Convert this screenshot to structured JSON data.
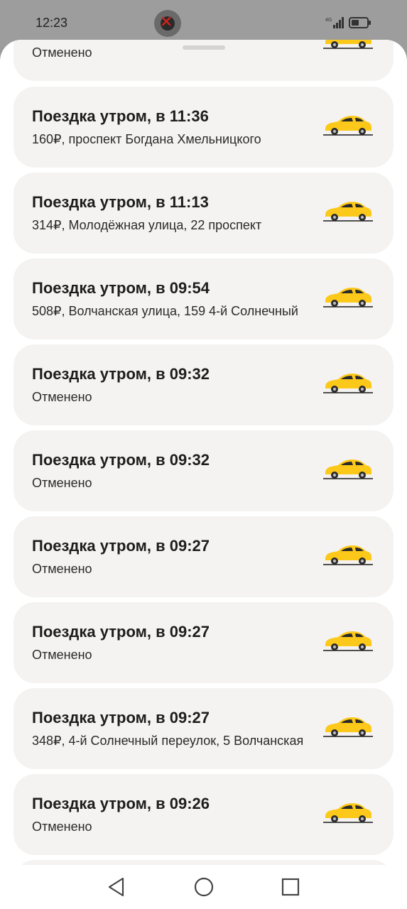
{
  "status_bar": {
    "time": "12:23",
    "network": "4G",
    "icons": [
      "notification-app-icon",
      "signal-icon",
      "battery-icon"
    ]
  },
  "trips": [
    {
      "title": "",
      "subtitle": "Отменено"
    },
    {
      "title": "Поездка утром, в 11:36",
      "subtitle": "160₽, проспект Богдана Хмельницкого"
    },
    {
      "title": "Поездка утром, в 11:13",
      "subtitle": "314₽, Молодёжная улица, 22 проспект"
    },
    {
      "title": "Поездка утром, в 09:54",
      "subtitle": "508₽, Волчанская улица, 159 4-й Солнечный"
    },
    {
      "title": "Поездка утром, в 09:32",
      "subtitle": "Отменено"
    },
    {
      "title": "Поездка утром, в 09:32",
      "subtitle": "Отменено"
    },
    {
      "title": "Поездка утром, в 09:27",
      "subtitle": "Отменено"
    },
    {
      "title": "Поездка утром, в 09:27",
      "subtitle": "Отменено"
    },
    {
      "title": "Поездка утром, в 09:27",
      "subtitle": "348₽, 4-й Солнечный переулок, 5 Волчанская"
    },
    {
      "title": "Поездка утром, в 09:26",
      "subtitle": "Отменено"
    }
  ],
  "colors": {
    "card_bg": "#f4f3f1",
    "car_yellow": "#fcc81a",
    "sheet_bg": "#ffffff",
    "status_bar_bg": "#9d9d9d"
  },
  "nav": {
    "icons": [
      "back-icon",
      "home-icon",
      "recents-icon"
    ]
  }
}
